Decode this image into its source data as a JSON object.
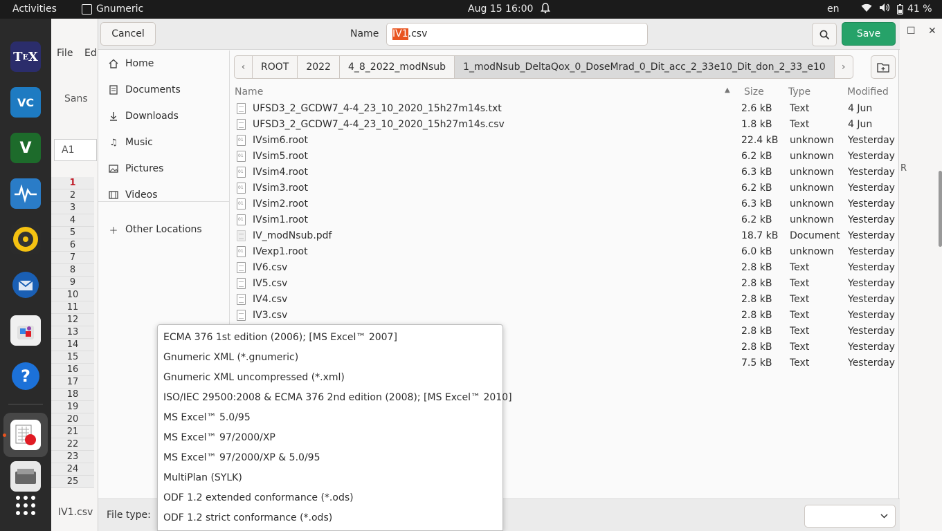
{
  "topbar": {
    "activities": "Activities",
    "app_name": "Gnumeric",
    "clock": "Aug 15  16:00",
    "lang": "en",
    "battery": "41 %"
  },
  "dock": [
    "TeXstudio",
    "VS Code",
    "Vim",
    "System Monitor",
    "Rhythmbox",
    "Thunderbird",
    "Software",
    "Help",
    "Gnumeric",
    "Files"
  ],
  "bg": {
    "menu_file": "File",
    "menu_edit": "Ed",
    "font": "Sans",
    "cell_ref": "A1",
    "col_r": "R",
    "sheet_tab": "IV1.csv",
    "rows": [
      "1",
      "2",
      "3",
      "4",
      "5",
      "6",
      "7",
      "8",
      "9",
      "10",
      "11",
      "12",
      "13",
      "14",
      "15",
      "16",
      "17",
      "18",
      "19",
      "20",
      "21",
      "22",
      "23",
      "24",
      "25"
    ]
  },
  "dialog": {
    "cancel": "Cancel",
    "name_label": "Name",
    "name_selected": "IV1",
    "name_rest": ".csv",
    "save": "Save",
    "file_type_label": "File type:"
  },
  "sidebar": [
    {
      "label": "Home",
      "icon": "home-icon"
    },
    {
      "label": "Documents",
      "icon": "documents-icon"
    },
    {
      "label": "Downloads",
      "icon": "downloads-icon"
    },
    {
      "label": "Music",
      "icon": "music-icon"
    },
    {
      "label": "Pictures",
      "icon": "pictures-icon"
    },
    {
      "label": "Videos",
      "icon": "videos-icon"
    },
    {
      "label": "Other Locations",
      "icon": "plus-icon"
    }
  ],
  "path": [
    "ROOT",
    "2022",
    "4_8_2022_modNsub",
    "1_modNsub_DeltaQox_0_DoseMrad_0_Dit_acc_2_33e10_Dit_don_2_33_e10"
  ],
  "columns": {
    "name": "Name",
    "size": "Size",
    "type": "Type",
    "modified": "Modified"
  },
  "files": [
    {
      "name": "UFSD3_2_GCDW7_4-4_23_10_2020_15h27m14s.txt",
      "size": "2.6 kB",
      "type": "Text",
      "modified": "4 Jun",
      "kind": "text"
    },
    {
      "name": "UFSD3_2_GCDW7_4-4_23_10_2020_15h27m14s.csv",
      "size": "1.8 kB",
      "type": "Text",
      "modified": "4 Jun",
      "kind": "text"
    },
    {
      "name": "IVsim6.root",
      "size": "22.4 kB",
      "type": "unknown",
      "modified": "Yesterday",
      "kind": "bin"
    },
    {
      "name": "IVsim5.root",
      "size": "6.2 kB",
      "type": "unknown",
      "modified": "Yesterday",
      "kind": "bin"
    },
    {
      "name": "IVsim4.root",
      "size": "6.3 kB",
      "type": "unknown",
      "modified": "Yesterday",
      "kind": "bin"
    },
    {
      "name": "IVsim3.root",
      "size": "6.2 kB",
      "type": "unknown",
      "modified": "Yesterday",
      "kind": "bin"
    },
    {
      "name": "IVsim2.root",
      "size": "6.3 kB",
      "type": "unknown",
      "modified": "Yesterday",
      "kind": "bin"
    },
    {
      "name": "IVsim1.root",
      "size": "6.2 kB",
      "type": "unknown",
      "modified": "Yesterday",
      "kind": "bin"
    },
    {
      "name": "IV_modNsub.pdf",
      "size": "18.7 kB",
      "type": "Document",
      "modified": "Yesterday",
      "kind": "pdf"
    },
    {
      "name": "IVexp1.root",
      "size": "6.0 kB",
      "type": "unknown",
      "modified": "Yesterday",
      "kind": "bin"
    },
    {
      "name": "IV6.csv",
      "size": "2.8 kB",
      "type": "Text",
      "modified": "Yesterday",
      "kind": "text"
    },
    {
      "name": "IV5.csv",
      "size": "2.8 kB",
      "type": "Text",
      "modified": "Yesterday",
      "kind": "text"
    },
    {
      "name": "IV4.csv",
      "size": "2.8 kB",
      "type": "Text",
      "modified": "Yesterday",
      "kind": "text"
    },
    {
      "name": "IV3.csv",
      "size": "2.8 kB",
      "type": "Text",
      "modified": "Yesterday",
      "kind": "text"
    },
    {
      "name": "",
      "size": "2.8 kB",
      "type": "Text",
      "modified": "Yesterday",
      "kind": "hidden"
    },
    {
      "name": "",
      "size": "2.8 kB",
      "type": "Text",
      "modified": "Yesterday",
      "kind": "hidden"
    },
    {
      "name": "",
      "size": "7.5 kB",
      "type": "Text",
      "modified": "Yesterday",
      "kind": "hidden"
    }
  ],
  "file_types": [
    "ECMA 376 1st edition (2006); [MS Excel™ 2007]",
    "Gnumeric XML (*.gnumeric)",
    "Gnumeric XML uncompressed (*.xml)",
    "ISO/IEC 29500:2008 & ECMA 376 2nd edition (2008); [MS Excel™ 2010]",
    "MS Excel™ 5.0/95",
    "MS Excel™ 97/2000/XP",
    "MS Excel™ 97/2000/XP & 5.0/95",
    "MultiPlan (SYLK)",
    "ODF 1.2 extended conformance (*.ods)",
    "ODF 1.2 strict conformance (*.ods)"
  ],
  "colors": {
    "accent": "#e95420",
    "save": "#26a269"
  }
}
